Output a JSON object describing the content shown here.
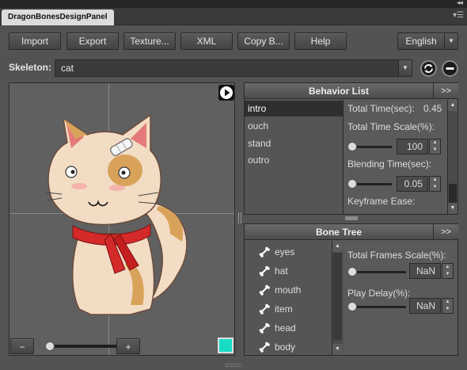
{
  "panel_tab": {
    "title": "DragonBonesDesignPanel",
    "collapse_glyph": "◂◂",
    "menu_glyph": "▾☰"
  },
  "toolbar": {
    "import_label": "Import",
    "export_label": "Export",
    "texture_label": "Texture...",
    "xml_label": "XML",
    "copy_label": "Copy B...",
    "help_label": "Help",
    "language_value": "English"
  },
  "skeleton": {
    "label": "Skeleton:",
    "value": "cat"
  },
  "preview": {
    "zoom_minus": "−",
    "zoom_plus": "+",
    "zoom_level": 0.12,
    "bg_color": "#18dcc6"
  },
  "behavior_list": {
    "title": "Behavior List",
    "expand_label": ">>",
    "items": [
      "intro",
      "ouch",
      "stand",
      "outro"
    ],
    "selected_index": 0,
    "total_time_label": "Total Time(sec):",
    "total_time_value": "0.45",
    "total_time_scale_label": "Total Time Scale(%):",
    "total_time_scale_value": "100",
    "total_time_scale_slider": 0.0,
    "blending_time_label": "Blending Time(sec):",
    "blending_time_value": "0.05",
    "blending_time_slider": 0.0,
    "keyframe_ease_label": "Keyframe Ease:"
  },
  "bone_tree": {
    "title": "Bone Tree",
    "expand_label": ">>",
    "items": [
      "eyes",
      "hat",
      "mouth",
      "item",
      "head",
      "body"
    ],
    "total_frames_scale_label": "Total Frames Scale(%):",
    "total_frames_scale_value": "NaN",
    "play_delay_label": "Play Delay(%):",
    "play_delay_value": "NaN"
  },
  "colors": {
    "panel_bg": "#535353",
    "accent_swatch": "#18dcc6",
    "scarf": "#d42a2a"
  }
}
